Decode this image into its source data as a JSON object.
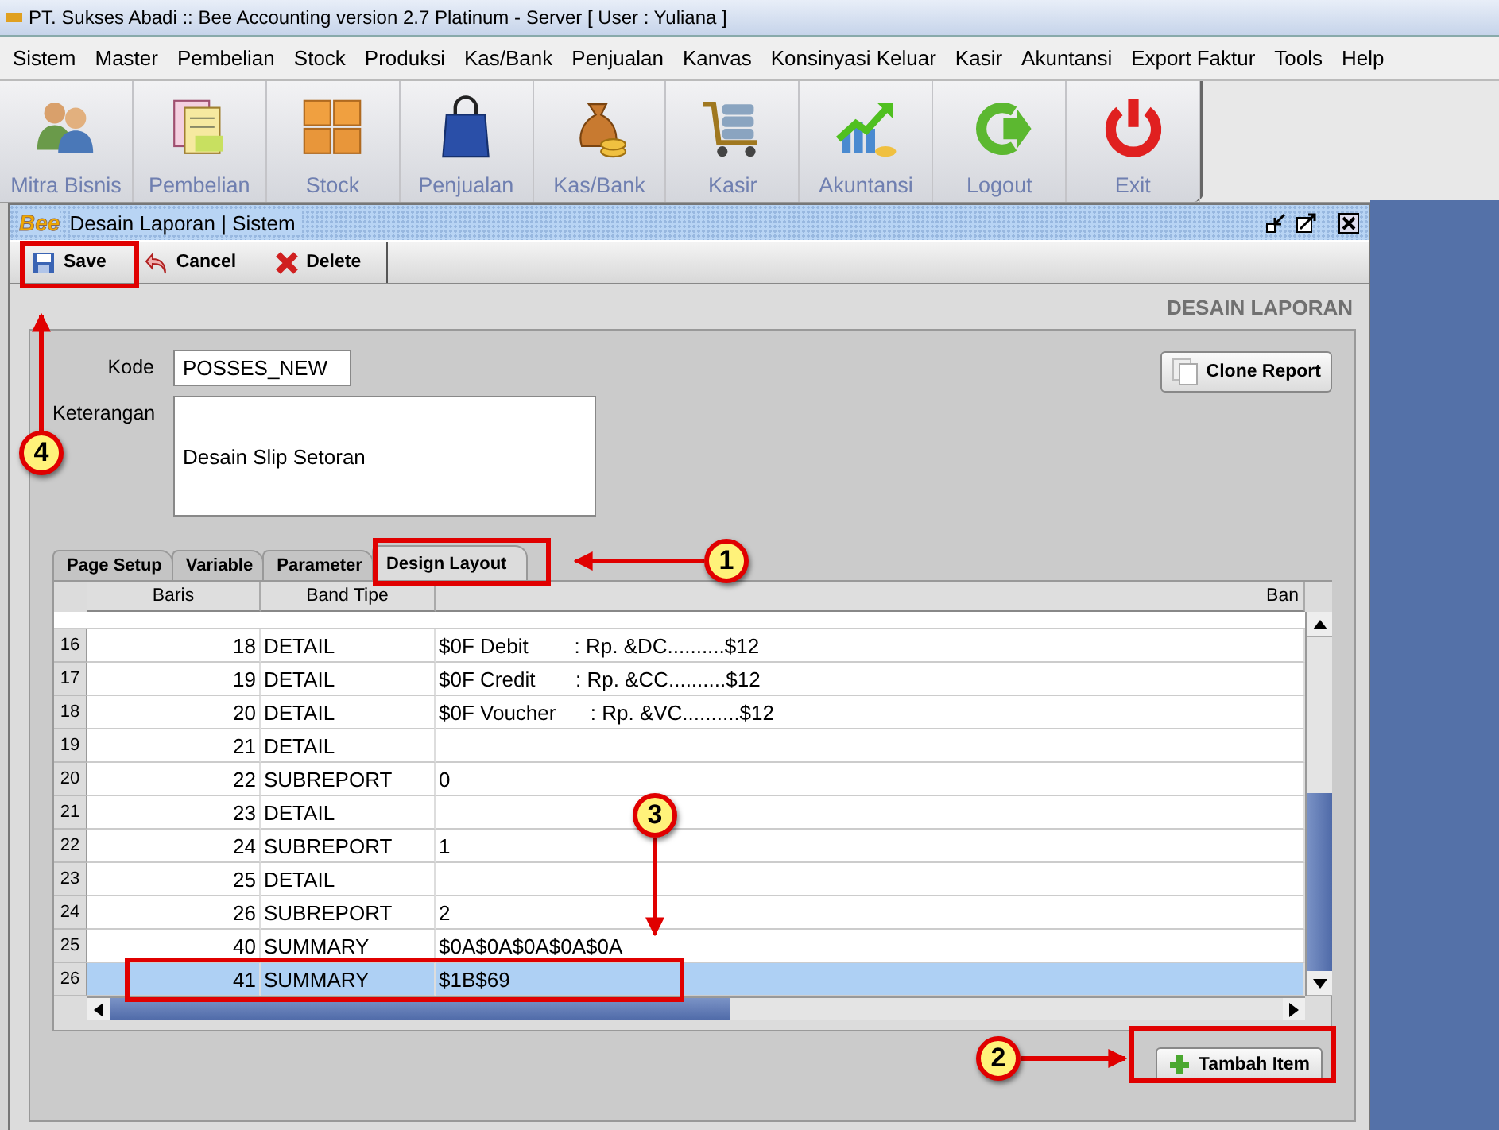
{
  "window": {
    "title": "PT. Sukses Abadi :: Bee Accounting version 2.7 Platinum - Server  [ User : Yuliana ]"
  },
  "menu": [
    "Sistem",
    "Master",
    "Pembelian",
    "Stock",
    "Produksi",
    "Kas/Bank",
    "Penjualan",
    "Kanvas",
    "Konsinyasi Keluar",
    "Kasir",
    "Akuntansi",
    "Export Faktur",
    "Tools",
    "Help"
  ],
  "toolbar": [
    "Mitra Bisnis",
    "Pembelian",
    "Stock",
    "Penjualan",
    "Kas/Bank",
    "Kasir",
    "Akuntansi",
    "Logout",
    "Exit"
  ],
  "frame": {
    "logo": "Bee",
    "title": "Desain Laporan | Sistem",
    "actions": [
      "Save",
      "Cancel",
      "Delete"
    ],
    "caption": "DESAIN LAPORAN",
    "fields": [
      {
        "label": "Kode",
        "value": "POSSES_NEW",
        "kind": "line"
      },
      {
        "label": "Keterangan",
        "value": "Desain Slip Setoran",
        "kind": "area"
      }
    ],
    "clone_button": "Clone Report",
    "tabs": [
      {
        "label": "Page Setup",
        "selected": false
      },
      {
        "label": "Variable",
        "selected": false
      },
      {
        "label": "Parameter",
        "selected": false
      },
      {
        "label": "Design Layout",
        "selected": true
      }
    ],
    "table": {
      "columns": [
        "Baris",
        "Band Tipe",
        "Ban"
      ],
      "rows": [
        {
          "number": "16",
          "baris": "18",
          "band": "DETAIL",
          "text": "$0F Debit        : Rp. &DC..........$12",
          "selected": false
        },
        {
          "number": "17",
          "baris": "19",
          "band": "DETAIL",
          "text": "$0F Credit       : Rp. &CC..........$12",
          "selected": false
        },
        {
          "number": "18",
          "baris": "20",
          "band": "DETAIL",
          "text": "$0F Voucher      : Rp. &VC..........$12",
          "selected": false
        },
        {
          "number": "19",
          "baris": "21",
          "band": "DETAIL",
          "text": "",
          "selected": false
        },
        {
          "number": "20",
          "baris": "22",
          "band": "SUBREPORT",
          "text": "0",
          "selected": false
        },
        {
          "number": "21",
          "baris": "23",
          "band": "DETAIL",
          "text": "",
          "selected": false
        },
        {
          "number": "22",
          "baris": "24",
          "band": "SUBREPORT",
          "text": "1",
          "selected": false
        },
        {
          "number": "23",
          "baris": "25",
          "band": "DETAIL",
          "text": "",
          "selected": false
        },
        {
          "number": "24",
          "baris": "26",
          "band": "SUBREPORT",
          "text": "2",
          "selected": false
        },
        {
          "number": "25",
          "baris": "40",
          "band": "SUMMARY",
          "text": "$0A$0A$0A$0A$0A",
          "selected": false
        },
        {
          "number": "26",
          "baris": "41",
          "band": "SUMMARY",
          "text": "$1B$69",
          "selected": true
        }
      ]
    },
    "add_button": "Tambah Item"
  },
  "annotations": [
    "1",
    "2",
    "3",
    "4"
  ]
}
